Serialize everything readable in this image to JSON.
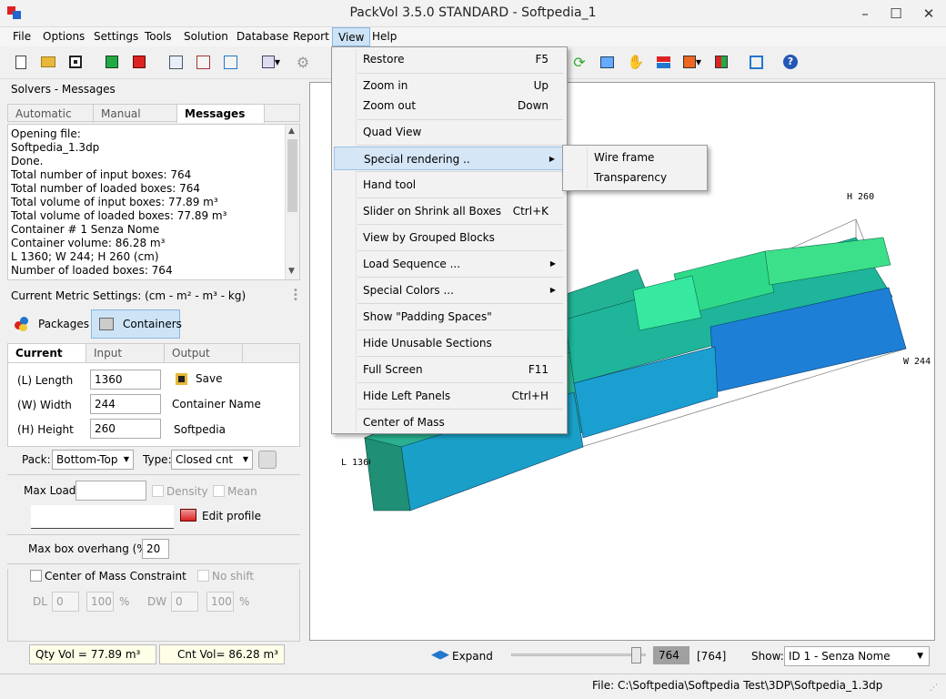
{
  "app": {
    "title": "PackVol 3.5.0 STANDARD - Softpedia_1",
    "minimize": "–",
    "maximize": "☐",
    "close": "✕"
  },
  "menu": [
    "File",
    "Options",
    "Settings",
    "Tools",
    "Solution",
    "Database",
    "Report",
    "View",
    "Help"
  ],
  "solvers": {
    "header": "Solvers - Messages",
    "tabs": [
      "Automatic",
      "Manual",
      "Messages"
    ],
    "messages": [
      "Opening file:",
      "Softpedia_1.3dp",
      "Done.",
      "Total number of input boxes: 764",
      "Total number of loaded boxes:  764",
      "Total volume of input boxes: 77.89 m³",
      "Total volume of loaded boxes: 77.89 m³",
      "Container # 1 Senza Nome",
      "Container volume: 86.28 m³",
      "L 1360; W 244; H 260 (cm)",
      "Number of loaded boxes: 764"
    ]
  },
  "metric": {
    "label": "Current Metric Settings: (cm - m² - m³ - kg)",
    "packages": "Packages",
    "containers": "Containers"
  },
  "dims": {
    "tabs": [
      "Current",
      "Input",
      "Output"
    ],
    "length_label": "(L) Length",
    "length": "1360",
    "width_label": "(W) Width",
    "width": "244",
    "height_label": "(H) Height",
    "height": "260",
    "save": "Save",
    "container_name_label": "Container Name",
    "container_name": "Softpedia"
  },
  "pack": {
    "pack_label": "Pack:",
    "pack_value": "Bottom-Top",
    "type_label": "Type:",
    "type_value": "Closed cnt",
    "max_load": "Max Load",
    "density": "Density",
    "mean": "Mean",
    "edit_profile": "Edit profile",
    "overhang_label": "Max box overhang (%)",
    "overhang": "20",
    "com": "Center of Mass Constraint",
    "no_shift": "No shift",
    "dl": "DL",
    "dl_val": "0",
    "dl_pct": "100",
    "dw": "DW",
    "dw_val": "0",
    "dw_pct": "100",
    "pct": "%"
  },
  "bottom": {
    "qty_vol": "Qty Vol = 77.89 m³",
    "cnt_vol": "Cnt Vol= 86.28 m³",
    "expand": "Expand",
    "slider_val": "764",
    "slider_total": "[764]",
    "show_label": "Show:",
    "show_value": "ID 1 - Senza Nome",
    "status_file": "File: C:\\Softpedia\\Softpedia Test\\3DP\\Softpedia_1.3dp"
  },
  "view3d": {
    "h": "H 260",
    "w": "W 244",
    "l": "L 1360"
  },
  "view_menu": [
    {
      "label": "Restore",
      "shortcut": "F5"
    },
    {
      "label": "Zoom in",
      "shortcut": "Up"
    },
    {
      "label": "Zoom out",
      "shortcut": "Down"
    },
    {
      "label": "Quad View",
      "shortcut": ""
    },
    {
      "label": "Special rendering ..",
      "shortcut": ""
    },
    {
      "label": "Hand tool",
      "shortcut": ""
    },
    {
      "label": "Slider on Shrink all Boxes",
      "shortcut": "Ctrl+K"
    },
    {
      "label": "View by Grouped Blocks",
      "shortcut": ""
    },
    {
      "label": "Load Sequence ...",
      "shortcut": ""
    },
    {
      "label": "Special Colors ...",
      "shortcut": ""
    },
    {
      "label": "Show \"Padding Spaces\"",
      "shortcut": ""
    },
    {
      "label": "Hide Unusable Sections",
      "shortcut": ""
    },
    {
      "label": "Full Screen",
      "shortcut": "F11"
    },
    {
      "label": "Hide Left Panels",
      "shortcut": "Ctrl+H"
    },
    {
      "label": "Center of Mass",
      "shortcut": ""
    }
  ],
  "sub_menu": [
    "Wire frame",
    "Transparency"
  ],
  "colors": {
    "accent": "#cde4f7",
    "highlight": "#d5e6f7",
    "box_blue": "#1e7fd6",
    "box_teal": "#1fb89a",
    "box_green": "#3de08a"
  }
}
